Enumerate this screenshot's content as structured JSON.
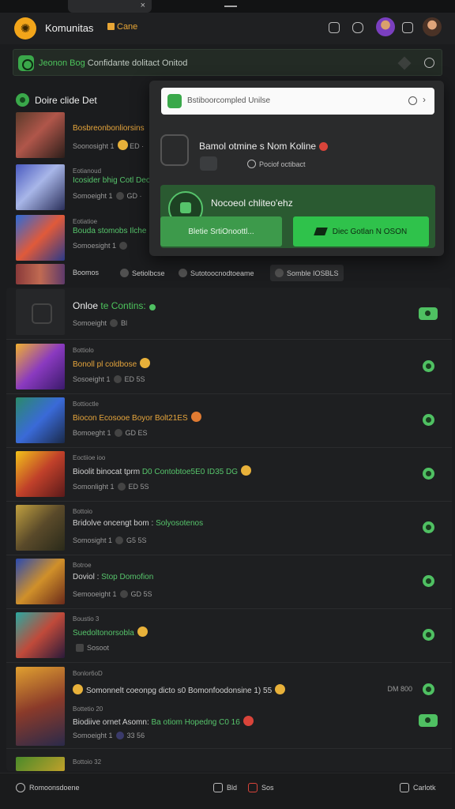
{
  "window": {
    "close_glyph": "×"
  },
  "header": {
    "logo_glyph": "✺",
    "title": "Komunitas",
    "cane_label": "Cane",
    "icons": [
      "gamepad-icon",
      "chat-icon",
      "avatar-purple",
      "bookmark-icon",
      "avatar-user"
    ]
  },
  "bar": {
    "text_green": "Jeonon  Bog",
    "text": " Confidante dolitact Onitod"
  },
  "section1": {
    "title": "Doire clide Det"
  },
  "items1": [
    {
      "meta": "",
      "title": "Bosbreonbonliorsins",
      "sub": "Soonosight 1",
      "sub2": "ED ·",
      "green": false
    },
    {
      "meta": "Eotianoud",
      "title": "Icosider bhig Cotl Deo",
      "sub": "Somoeight 1",
      "sub2": "GD ·",
      "green": true
    },
    {
      "meta": "Eotiatioe",
      "title": "Bouda stomobs Ilche",
      "sub": "Somoesight 1",
      "sub2": "",
      "green": true
    }
  ],
  "filters": [
    {
      "label": "Boomos"
    },
    {
      "label": "Setiolbcse"
    },
    {
      "label": "Sutotoocnodtoeame"
    },
    {
      "label": "Somble IOSBLS"
    }
  ],
  "panel": {
    "input_value": "Bstiboorcompled Unilse",
    "chevron": "›",
    "heading": "Bamol otmine s Nom Koline",
    "sub": "Pociof octibact",
    "green_title": "Nocoeol chliteo'ehz",
    "btn1": "Bletie SrtiOnoottl...",
    "btn2": "Diec Gotlan N OSON"
  },
  "list": {
    "online_title": "Onloe",
    "online_title_green": " te Contins:",
    "online_sub": "Somoeight",
    "online_sub2": "Bl",
    "rows": [
      {
        "meta": "Bottiolo",
        "title": "Bonoll pl coldbose",
        "sub": "Sosoeight 1",
        "sub2": "ED 5S"
      },
      {
        "meta": "Bottioctle",
        "title": "Biocon Ecosooe Boyor Bolt21ES",
        "sub": "Bomoeght 1",
        "sub2": "GD ES"
      },
      {
        "meta": "Eoctiioe ioo",
        "title": "Bioolit binocat tprm",
        "title_green": "D0 Contobtoe5E0 ID35 DG",
        "sub": "Somonlight 1",
        "sub2": "ED 5S"
      },
      {
        "meta": "Bottoio",
        "title": "Bridolve oncengt bom :",
        "title_green": "Solyosotenos",
        "sub": "Somosight 1",
        "sub2": "G5 5S"
      },
      {
        "meta": "Botroe",
        "title": "Doviol :",
        "title_green": "Stop Domofion",
        "sub": "Semooeight 1",
        "sub2": "GD 5S"
      },
      {
        "meta": "Boustio 3",
        "title": "Suedoltonorsobla",
        "sub": "Sosoot",
        "sub2": ""
      }
    ],
    "last": {
      "meta": "Bonlor6oD",
      "line": "Somonnelt coeonpg dicto s0 Bomonfoodonsine 1) 55",
      "right": "DM 800",
      "meta2": "Bottetio 20",
      "title2": "Biodiive ornet Asomn:",
      "title2_green": "Ba otiom Hopedng C0 16",
      "sub": "Somoeight 1",
      "sub2": "33 56"
    },
    "peek": {
      "meta": "Bottoio 32"
    }
  },
  "footer": {
    "left": "Romoonsdoene",
    "mid1": "Bld",
    "mid2": "Sos",
    "right": "Carlotk"
  },
  "colors": {
    "accent_green": "#4dc45c",
    "accent_orange": "#e6a53c",
    "background": "#1b1c1e",
    "panel": "#2a2b2c"
  }
}
